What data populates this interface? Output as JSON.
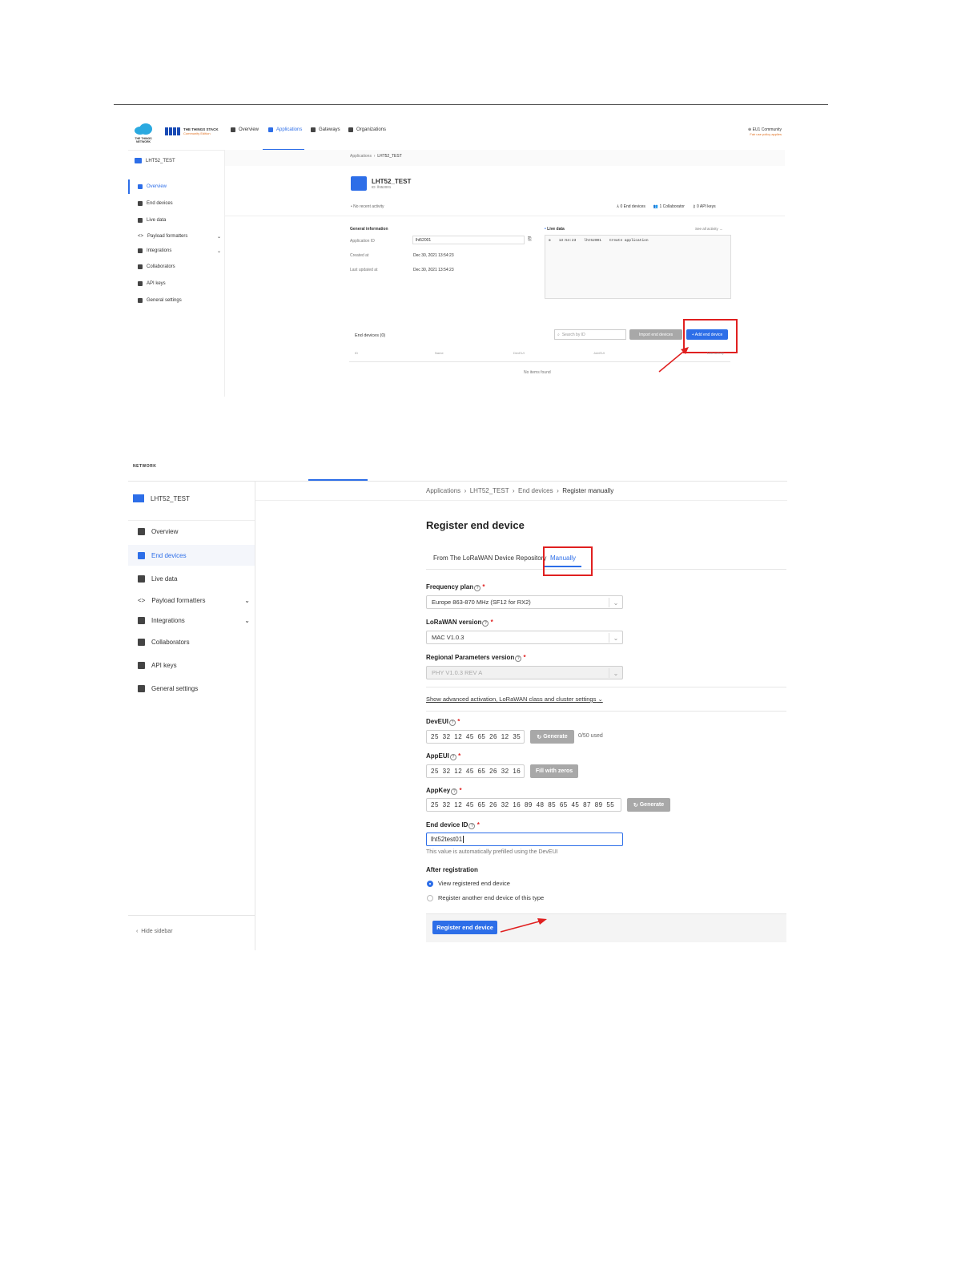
{
  "shot1": {
    "brand": {
      "logo_text": "THE THINGS NETWORK",
      "stack_title": "THE THINGS STACK",
      "stack_subtitle": "Community Edition"
    },
    "nav": [
      {
        "label": "Overview"
      },
      {
        "label": "Applications"
      },
      {
        "label": "Gateways"
      },
      {
        "label": "Organizations"
      }
    ],
    "account": {
      "cluster": "EU1 Community",
      "fair_use": "Fair use policy applies"
    },
    "app_title": "LHT52_TEST",
    "sidebar": [
      {
        "label": "Overview"
      },
      {
        "label": "End devices"
      },
      {
        "label": "Live data"
      },
      {
        "label": "Payload formatters"
      },
      {
        "label": "Integrations"
      },
      {
        "label": "Collaborators"
      },
      {
        "label": "API keys"
      },
      {
        "label": "General settings"
      }
    ],
    "breadcrumb": [
      "Applications",
      "LHT52_TEST"
    ],
    "app_header": {
      "title": "LHT52_TEST",
      "id": "ID: lht52001"
    },
    "no_activity": "No recent activity",
    "stats": [
      "0 End devices",
      "1 Collaborator",
      "0 API keys"
    ],
    "general_info": {
      "heading": "General information",
      "rows": [
        {
          "label": "Application ID",
          "value": "lht52001"
        },
        {
          "label": "Created at",
          "value": "Dec 30, 2021 13:54:23"
        },
        {
          "label": "Last updated at",
          "value": "Dec 30, 2021 13:54:23"
        }
      ]
    },
    "live_data": {
      "heading": "Live data",
      "see_all": "See all activity →",
      "entry_time": "13:54:23",
      "entry_id": "lht52001",
      "entry_text": "Create application"
    },
    "end_devices": {
      "title": "End devices (0)",
      "search_placeholder": "Search by ID",
      "import_label": "Import end devices",
      "add_label": "+ Add end device",
      "columns": [
        "ID",
        "Name",
        "DevEUI",
        "JoinEUI",
        "Last activity"
      ],
      "empty": "No items found"
    }
  },
  "shot2": {
    "top_logo": "NETWORK",
    "breadcrumb": [
      "Applications",
      "LHT52_TEST",
      "End devices",
      "Register manually"
    ],
    "app_title": "LHT52_TEST",
    "sidebar": [
      {
        "label": "Overview"
      },
      {
        "label": "End devices"
      },
      {
        "label": "Live data"
      },
      {
        "label": "Payload formatters"
      },
      {
        "label": "Integrations"
      },
      {
        "label": "Collaborators"
      },
      {
        "label": "API keys"
      },
      {
        "label": "General settings"
      }
    ],
    "hide_sidebar": "Hide sidebar",
    "page_title": "Register end device",
    "tabs": [
      "From The LoRaWAN Device Repository",
      "Manually"
    ],
    "frequency_plan": {
      "label": "Frequency plan",
      "value": "Europe 863-870 MHz (SF12 for RX2)"
    },
    "lorawan_version": {
      "label": "LoRaWAN version",
      "value": "MAC V1.0.3"
    },
    "regional_params": {
      "label": "Regional Parameters version",
      "value": "PHY V1.0.3 REV A"
    },
    "advanced_link": "Show advanced activation, LoRaWAN class and cluster settings",
    "dev_eui": {
      "label": "DevEUI",
      "value": "25 32 12 45 65 26 12 35",
      "button": "Generate",
      "usage": "0/50 used"
    },
    "app_eui": {
      "label": "AppEUI",
      "value": "25 32 12 45 65 26 32 16",
      "button": "Fill with zeros"
    },
    "app_key": {
      "label": "AppKey",
      "value": "25 32 12 45 65 26 32 16 89 48 85 65 45 87 89 55",
      "button": "Generate"
    },
    "end_device_id": {
      "label": "End device ID",
      "value": "lht52test01",
      "hint": "This value is automatically prefilled using the DevEUI"
    },
    "after_registration": {
      "label": "After registration",
      "options": [
        "View registered end device",
        "Register another end device of this type"
      ],
      "selected": 0
    },
    "submit": "Register end device"
  }
}
